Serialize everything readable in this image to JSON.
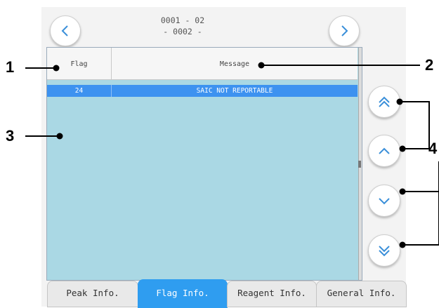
{
  "header": {
    "line1": "0001 - 02",
    "line2": "- 0002 -",
    "prev_icon": "chevron-left-icon",
    "next_icon": "chevron-right-icon"
  },
  "table": {
    "columns": [
      "Flag",
      "Message"
    ],
    "rows": [
      {
        "flag": "24",
        "message": "SAIC NOT REPORTABLE",
        "selected": true
      }
    ]
  },
  "scroll_buttons": [
    {
      "name": "scroll-to-top-button",
      "icon": "double-chevron-up-icon"
    },
    {
      "name": "scroll-up-button",
      "icon": "chevron-up-icon"
    },
    {
      "name": "scroll-down-button",
      "icon": "chevron-down-icon"
    },
    {
      "name": "scroll-to-bottom-button",
      "icon": "double-chevron-down-icon"
    }
  ],
  "tabs": [
    {
      "label": "Peak Info.",
      "active": false
    },
    {
      "label": "Flag Info.",
      "active": true
    },
    {
      "label": "Reagent Info.",
      "active": false
    },
    {
      "label": "General Info.",
      "active": false
    }
  ],
  "callouts": [
    "1",
    "2",
    "3",
    "4"
  ],
  "colors": {
    "accent": "#2f9df0",
    "selected_row": "#3d92f0",
    "table_bg": "#aad8e4",
    "icon_blue": "#3a8fd9"
  }
}
